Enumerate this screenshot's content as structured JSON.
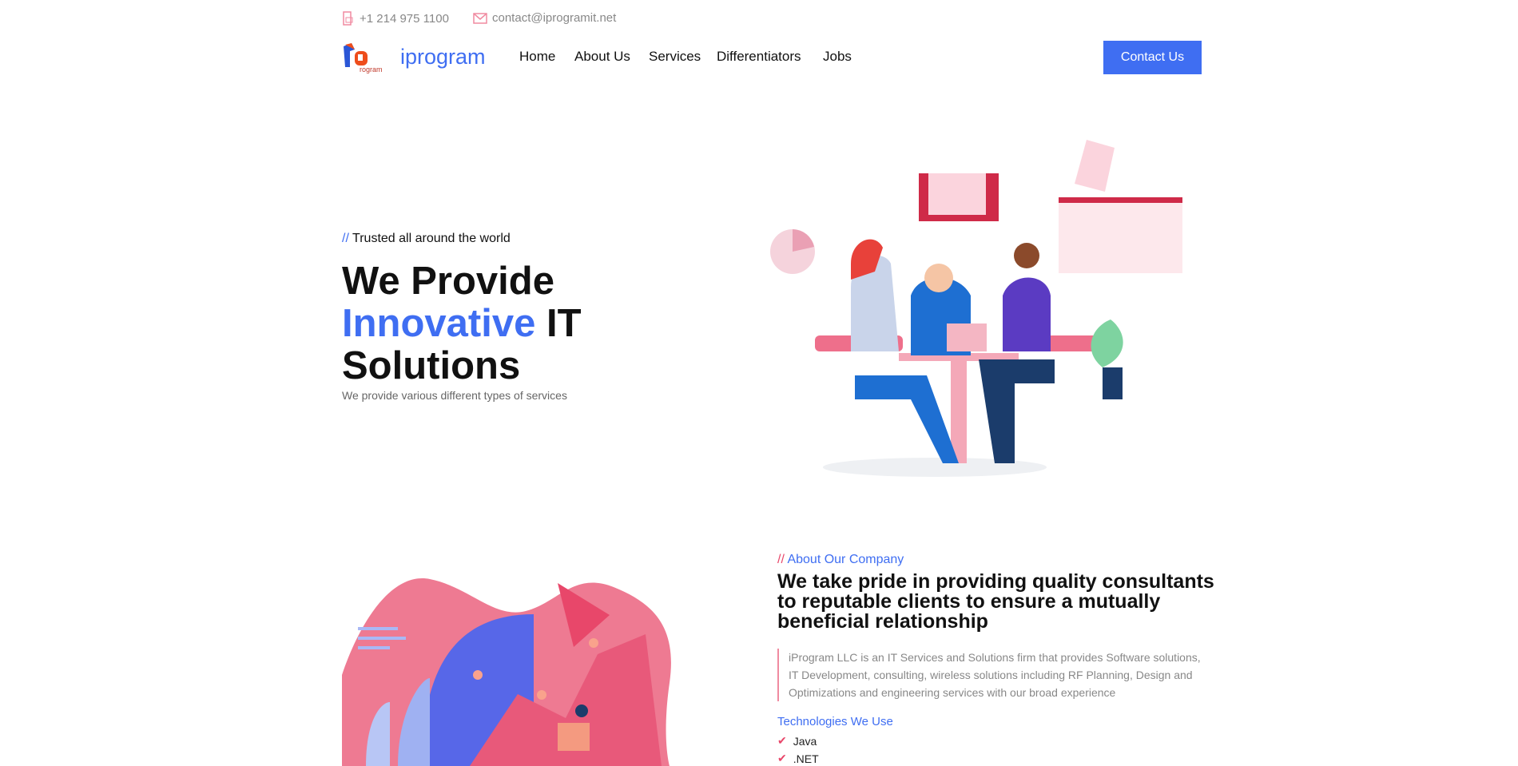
{
  "topbar": {
    "phone": "+1 214 975 1100",
    "email": "contact@iprogramit.net"
  },
  "nav": {
    "brand": "iprogram",
    "items": [
      "Home",
      "About Us",
      "Services",
      "Differentiators",
      "Jobs"
    ],
    "cta": "Contact Us"
  },
  "hero": {
    "tagline_prefix": "//",
    "tagline": "Trusted all around the world",
    "title_1": "We Provide",
    "title_blue": "Innovative",
    "title_2": "IT",
    "title_3": "Solutions",
    "subtitle": "We provide various different types of services"
  },
  "about": {
    "label_prefix": "//",
    "label": "About Our Company",
    "heading": "We take pride in providing quality consultants to reputable clients to ensure a mutually beneficial relationship",
    "paragraph": "iProgram LLC is an IT Services and Solutions firm that provides Software solutions, IT Development, consulting, wireless solutions including RF Planning, Design and Optimizations and engineering services with our broad experience",
    "tech_title": "Technologies We Use",
    "tech": [
      "Java",
      ".NET"
    ]
  },
  "colors": {
    "accent": "#3f6ef2",
    "pink": "#e8476a"
  }
}
